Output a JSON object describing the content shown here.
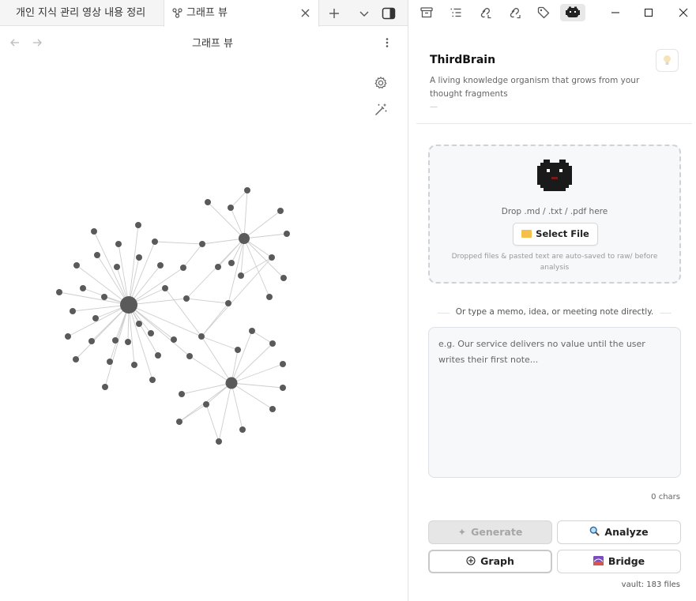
{
  "tabs": {
    "tab1_label": "개인 지식 관리 영상 내용 정리",
    "tab2_label": "그래프 뷰"
  },
  "view": {
    "title": "그래프 뷰"
  },
  "right_panel": {
    "title": "ThirdBrain",
    "description": "A living knowledge organism that grows from your thought fragments",
    "dash": "—",
    "drop_hint": "Drop .md / .txt / .pdf here",
    "select_file_label": "Select File",
    "drop_note": "Dropped files & pasted text are auto-saved to raw/ before analysis",
    "or_text": "Or type a memo, idea, or meeting note directly.",
    "memo_placeholder": "e.g. Our service delivers no value until the user writes their first note...",
    "char_count": "0 chars",
    "generate_label": "Generate",
    "analyze_label": "Analyze",
    "graph_label": "Graph",
    "bridge_label": "Bridge",
    "vault_count": "vault: 183 files"
  },
  "colors": {
    "node": "#5a5a5a",
    "edge": "#cdcdcd",
    "accent_disabled": "#e6e6e6",
    "folder": "#f5c04a",
    "bridge_icon": "#7b4dbf"
  }
}
